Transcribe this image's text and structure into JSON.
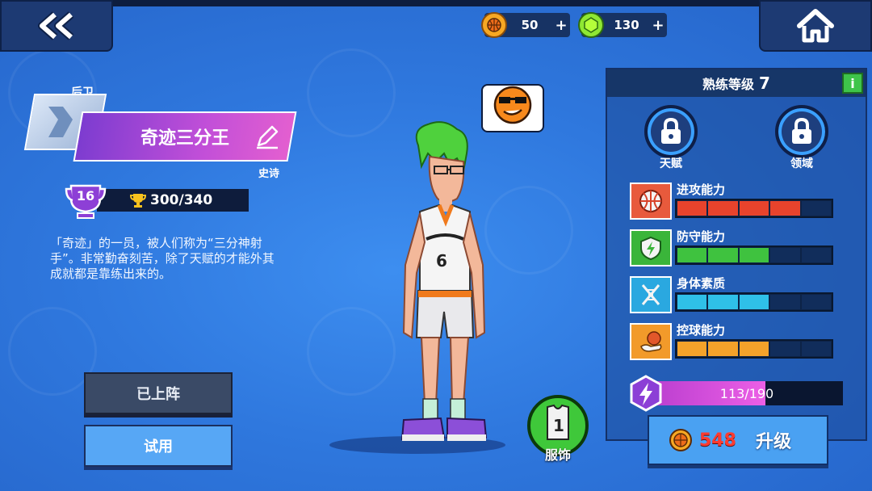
{
  "currency": {
    "basketball_coins": "50",
    "gems": "130",
    "plus": "+"
  },
  "hero": {
    "position": "后卫",
    "name": "奇迹三分王",
    "rarity": "史诗",
    "level": "16",
    "trophy_progress": "300/340",
    "description": "「奇迹」的一员，被人们称为“三分神射手”。非常勤奋刻苦，除了天赋的才能外其成就都是靠练出来的。"
  },
  "buttons": {
    "deployed": "已上阵",
    "try": "试用",
    "outfit": "服饰",
    "outfit_count": "1"
  },
  "jersey_number": "6",
  "panel": {
    "title": "熟练等级",
    "level": "7",
    "info": "i",
    "locks": [
      {
        "label": "天赋"
      },
      {
        "label": "领域"
      }
    ],
    "stats": [
      {
        "name": "进攻能力",
        "filled": 4,
        "total": 5,
        "color": "#e8432c",
        "icon_bg": "#e85a3c",
        "icon": "basketball-icon"
      },
      {
        "name": "防守能力",
        "filled": 3,
        "total": 5,
        "color": "#3fc23f",
        "icon_bg": "#3ab53a",
        "icon": "shield-icon"
      },
      {
        "name": "身体素质",
        "filled": 3,
        "total": 5,
        "color": "#2fc0e8",
        "icon_bg": "#2aa8e0",
        "icon": "dna-icon"
      },
      {
        "name": "控球能力",
        "filled": 3,
        "total": 5,
        "color": "#f4a22a",
        "icon_bg": "#f29a2a",
        "icon": "hand-ball-icon"
      }
    ],
    "exp": "113/190",
    "exp_fraction": 0.595,
    "upgrade_cost": "548",
    "upgrade_label": "升级"
  }
}
